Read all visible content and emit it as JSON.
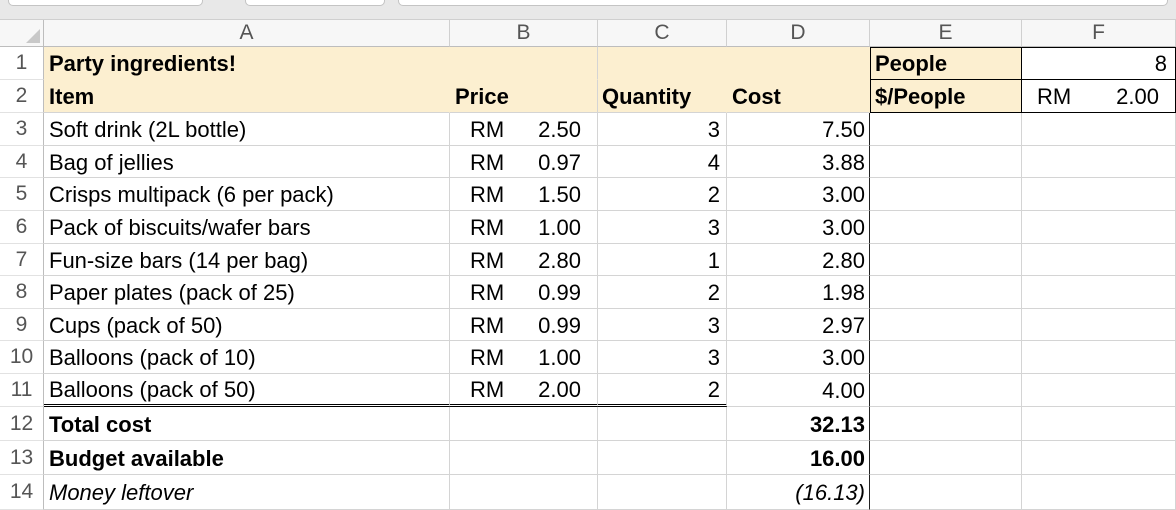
{
  "colors": {
    "header_fill": "#fcefd0",
    "gridline": "#d4d4d4",
    "box_border": "#000000"
  },
  "sheet": {
    "columns": [
      "A",
      "B",
      "C",
      "D",
      "E",
      "F"
    ],
    "rows": [
      {
        "num": "1",
        "A": "Party ingredients!",
        "E": "People",
        "F": "8"
      },
      {
        "num": "2",
        "A": "Item",
        "B": "Price",
        "C": "Quantity",
        "D": "Cost",
        "E": "$/People",
        "F_cur": "RM",
        "F": "2.00"
      },
      {
        "num": "3",
        "A": "Soft drink (2L bottle)",
        "B_cur": "RM",
        "B": "2.50",
        "C": "3",
        "D": "7.50"
      },
      {
        "num": "4",
        "A": "Bag of jellies",
        "B_cur": "RM",
        "B": "0.97",
        "C": "4",
        "D": "3.88"
      },
      {
        "num": "5",
        "A": "Crisps multipack (6 per pack)",
        "B_cur": "RM",
        "B": "1.50",
        "C": "2",
        "D": "3.00"
      },
      {
        "num": "6",
        "A": "Pack of biscuits/wafer bars",
        "B_cur": "RM",
        "B": "1.00",
        "C": "3",
        "D": "3.00"
      },
      {
        "num": "7",
        "A": "Fun-size bars (14 per bag)",
        "B_cur": "RM",
        "B": "2.80",
        "C": "1",
        "D": "2.80"
      },
      {
        "num": "8",
        "A": "Paper plates (pack of 25)",
        "B_cur": "RM",
        "B": "0.99",
        "C": "2",
        "D": "1.98"
      },
      {
        "num": "9",
        "A": "Cups (pack of 50)",
        "B_cur": "RM",
        "B": "0.99",
        "C": "3",
        "D": "2.97"
      },
      {
        "num": "10",
        "A": "Balloons (pack of 10)",
        "B_cur": "RM",
        "B": "1.00",
        "C": "3",
        "D": "3.00"
      },
      {
        "num": "11",
        "A": "Balloons (pack of 50)",
        "B_cur": "RM",
        "B": "2.00",
        "C": "2",
        "D": "4.00"
      },
      {
        "num": "12",
        "A": "Total cost",
        "D": "32.13"
      },
      {
        "num": "13",
        "A": "Budget available",
        "D": "16.00"
      },
      {
        "num": "14",
        "A": "Money leftover",
        "D": "(16.13)"
      }
    ]
  }
}
